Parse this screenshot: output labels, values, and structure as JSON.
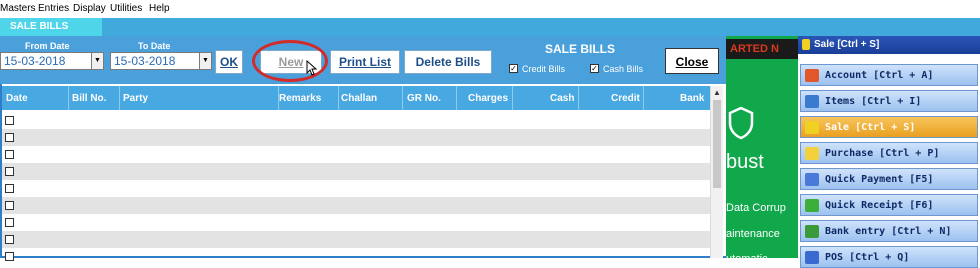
{
  "menubar": {
    "items": [
      "Masters",
      "Entries",
      "Display",
      "Utilities",
      "Help"
    ]
  },
  "tab": {
    "label": "SALE BILLS"
  },
  "filter": {
    "from_label": "From Date",
    "from_value": "15-03-2018",
    "to_label": "To Date",
    "to_value": "15-03-2018",
    "ok_label": "OK",
    "new_label": "New",
    "print_label": "Print List",
    "delete_label": "Delete Bills",
    "title": "SALE BILLS",
    "credit_label": "Credit Bills",
    "cash_label": "Cash Bills",
    "credit_checked": true,
    "cash_checked": true,
    "close_label": "Close"
  },
  "grid": {
    "columns": [
      "Date",
      "Bill No.",
      "Party",
      "Remarks",
      "Challan",
      "GR No.",
      "Charges",
      "Cash",
      "Credit",
      "Bank"
    ],
    "row_count": 9
  },
  "promo": {
    "banner": "ARTED N",
    "word": "bust",
    "line1": "Data Corrup",
    "line2": "aintenance",
    "line3": "utomatic"
  },
  "sidepanel": {
    "header": "Sale [Ctrl + S]",
    "items": [
      {
        "label": "Account [Ctrl + A]",
        "icon": "account-icon",
        "color": "#e2572a"
      },
      {
        "label": "Items [Ctrl + I]",
        "icon": "items-icon",
        "color": "#3a7bd0"
      },
      {
        "label": "Sale [Ctrl + S]",
        "icon": "sale-icon",
        "color": "#f0d020",
        "active": true
      },
      {
        "label": "Purchase [Ctrl + P]",
        "icon": "purchase-icon",
        "color": "#f3d13a"
      },
      {
        "label": "Quick Payment [F5]",
        "icon": "payment-icon",
        "color": "#4a7ad8"
      },
      {
        "label": "Quick Receipt [F6]",
        "icon": "receipt-icon",
        "color": "#3cae3c"
      },
      {
        "label": "Bank entry [Ctrl + N]",
        "icon": "bank-icon",
        "color": "#3a9a3a"
      },
      {
        "label": "POS [Ctrl + Q]",
        "icon": "pos-icon",
        "color": "#3a6ad0"
      }
    ]
  }
}
